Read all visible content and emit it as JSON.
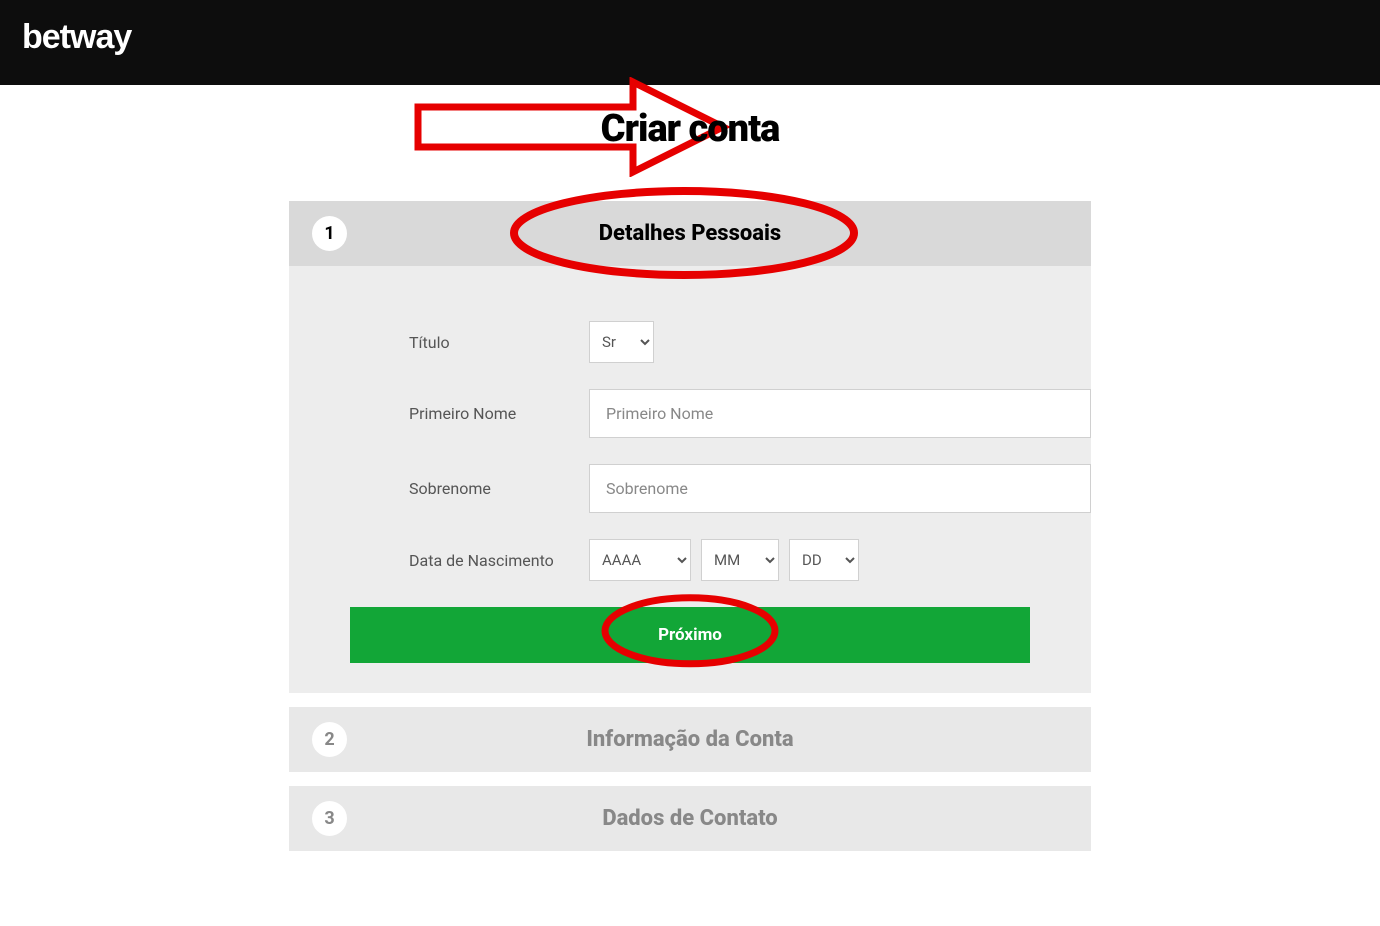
{
  "header": {
    "brand": "betway"
  },
  "page": {
    "title": "Criar conta"
  },
  "annotations": {
    "arrow_color": "#e60000",
    "ellipse_color": "#e60000"
  },
  "steps": {
    "step1": {
      "number": "1",
      "title": "Detalhes Pessoais",
      "active": true
    },
    "step2": {
      "number": "2",
      "title": "Informação da Conta",
      "active": false
    },
    "step3": {
      "number": "3",
      "title": "Dados de Contato",
      "active": false
    }
  },
  "form": {
    "title_label": "Título",
    "title_value": "Sr",
    "first_name_label": "Primeiro Nome",
    "first_name_placeholder": "Primeiro Nome",
    "last_name_label": "Sobrenome",
    "last_name_placeholder": "Sobrenome",
    "dob_label": "Data de Nascimento",
    "dob_year": "AAAA",
    "dob_month": "MM",
    "dob_day": "DD",
    "next_button": "Próximo"
  },
  "colors": {
    "header_bg": "#0d0d0d",
    "step_active_bg": "#d9d9d9",
    "step_inactive_bg": "#e8e8e8",
    "body_bg": "#ededed",
    "next_button_bg": "#12a637"
  }
}
